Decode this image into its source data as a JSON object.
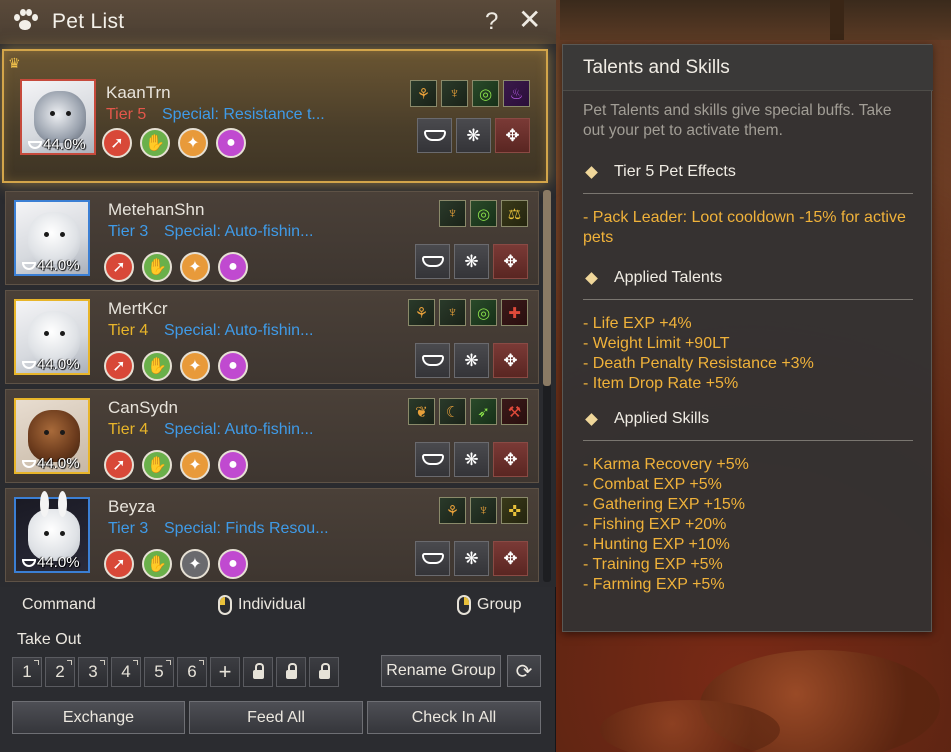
{
  "window": {
    "title": "Pet List",
    "help": "?",
    "close": "✕"
  },
  "pets": [
    {
      "name": "KaanTrn",
      "tier": "Tier 5",
      "special": "Special: Resistance t...",
      "percent": "44.0%",
      "hunger": 0.44
    },
    {
      "name": "MetehanShn",
      "tier": "Tier 3",
      "special": "Special: Auto-fishin...",
      "percent": "44.0%",
      "hunger": 0.44
    },
    {
      "name": "MertKcr",
      "tier": "Tier 4",
      "special": "Special: Auto-fishin...",
      "percent": "44.0%",
      "hunger": 0.44
    },
    {
      "name": "CanSydn",
      "tier": "Tier 4",
      "special": "Special: Auto-fishin...",
      "percent": "44.0%",
      "hunger": 0.44
    },
    {
      "name": "Beyza",
      "tier": "Tier 3",
      "special": "Special: Finds Resou...",
      "percent": "44.0%",
      "hunger": 0.44
    }
  ],
  "command_bar": {
    "command": "Command",
    "individual": "Individual",
    "group": "Group"
  },
  "take_out": {
    "label": "Take Out",
    "slots": [
      "1",
      "2",
      "3",
      "4",
      "5",
      "6"
    ],
    "add": "+",
    "rename": "Rename Group"
  },
  "bottom_buttons": {
    "exchange": "Exchange",
    "feed_all": "Feed All",
    "check_in_all": "Check In All"
  },
  "tooltip": {
    "title": "Talents and Skills",
    "description": "Pet Talents and skills give special buffs. Take out your pet to activate them.",
    "sections": [
      {
        "title": "Tier 5 Pet Effects",
        "lines": [
          "- Pack Leader: Loot cooldown -15% for active pets"
        ]
      },
      {
        "title": "Applied Talents",
        "lines": [
          "- Life EXP +4%",
          "- Weight Limit +90LT",
          "- Death Penalty Resistance +3%",
          "- Item Drop Rate +5%"
        ]
      },
      {
        "title": "Applied Skills",
        "lines": [
          "- Karma Recovery +5%",
          "- Combat EXP +5%",
          "- Gathering EXP +15%",
          "- Fishing EXP +20%",
          "- Hunting EXP +10%",
          "- Training EXP +5%",
          "- Farming EXP +5%"
        ]
      }
    ]
  },
  "colors": {
    "tier_red": "#e4574a",
    "tier_blue": "#3f9be8",
    "tier_gold": "#e8b52a",
    "tooltip_text": "#f0b23a"
  }
}
